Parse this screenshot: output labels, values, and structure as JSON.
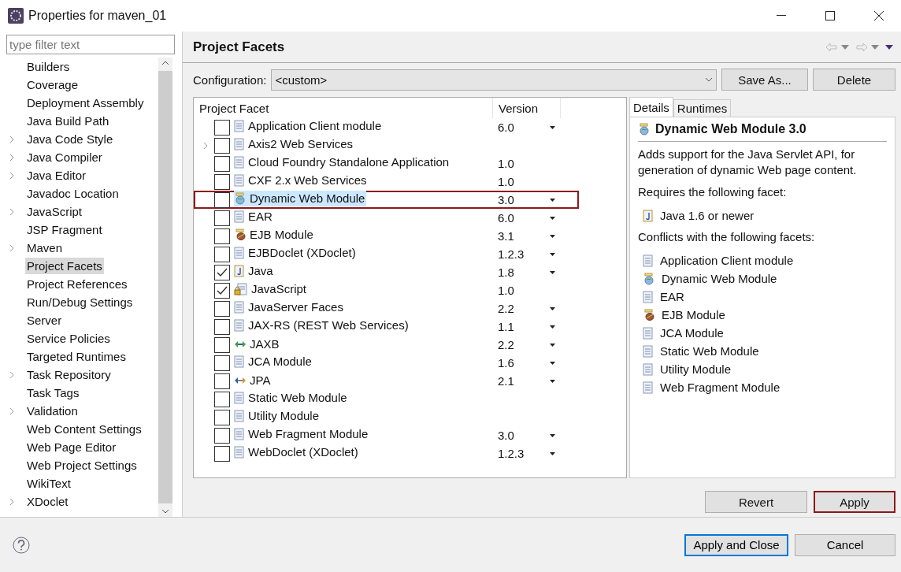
{
  "window": {
    "title": "Properties for maven_01"
  },
  "sidebar": {
    "filter": {
      "placeholder": "type filter text"
    },
    "items": [
      {
        "label": "Builders",
        "expandable": false,
        "selected": false
      },
      {
        "label": "Coverage",
        "expandable": false,
        "selected": false
      },
      {
        "label": "Deployment Assembly",
        "expandable": false,
        "selected": false
      },
      {
        "label": "Java Build Path",
        "expandable": false,
        "selected": false
      },
      {
        "label": "Java Code Style",
        "expandable": true,
        "selected": false
      },
      {
        "label": "Java Compiler",
        "expandable": true,
        "selected": false
      },
      {
        "label": "Java Editor",
        "expandable": true,
        "selected": false
      },
      {
        "label": "Javadoc Location",
        "expandable": false,
        "selected": false
      },
      {
        "label": "JavaScript",
        "expandable": true,
        "selected": false
      },
      {
        "label": "JSP Fragment",
        "expandable": false,
        "selected": false
      },
      {
        "label": "Maven",
        "expandable": true,
        "selected": false
      },
      {
        "label": "Project Facets",
        "expandable": false,
        "selected": true
      },
      {
        "label": "Project References",
        "expandable": false,
        "selected": false
      },
      {
        "label": "Run/Debug Settings",
        "expandable": false,
        "selected": false
      },
      {
        "label": "Server",
        "expandable": false,
        "selected": false
      },
      {
        "label": "Service Policies",
        "expandable": false,
        "selected": false
      },
      {
        "label": "Targeted Runtimes",
        "expandable": false,
        "selected": false
      },
      {
        "label": "Task Repository",
        "expandable": true,
        "selected": false
      },
      {
        "label": "Task Tags",
        "expandable": false,
        "selected": false
      },
      {
        "label": "Validation",
        "expandable": true,
        "selected": false
      },
      {
        "label": "Web Content Settings",
        "expandable": false,
        "selected": false
      },
      {
        "label": "Web Page Editor",
        "expandable": false,
        "selected": false
      },
      {
        "label": "Web Project Settings",
        "expandable": false,
        "selected": false
      },
      {
        "label": "WikiText",
        "expandable": false,
        "selected": false
      },
      {
        "label": "XDoclet",
        "expandable": true,
        "selected": false
      }
    ]
  },
  "page": {
    "title": "Project Facets",
    "configuration": {
      "label": "Configuration:",
      "value": "<custom>",
      "buttons": [
        "Save As...",
        "Delete"
      ]
    },
    "table": {
      "columns": [
        "Project Facet",
        "Version"
      ],
      "rows": [
        {
          "name": "Application Client module",
          "kind": "doc",
          "version": "6.0",
          "dropdown": true,
          "checked": false,
          "expandable": false,
          "selected": false
        },
        {
          "name": "Axis2 Web Services",
          "kind": "doc",
          "version": "",
          "dropdown": false,
          "checked": false,
          "expandable": true,
          "selected": false
        },
        {
          "name": "Cloud Foundry Standalone Application",
          "kind": "doc",
          "version": "1.0",
          "dropdown": false,
          "checked": false,
          "expandable": false,
          "selected": false
        },
        {
          "name": "CXF 2.x Web Services",
          "kind": "doc",
          "version": "1.0",
          "dropdown": false,
          "checked": false,
          "expandable": false,
          "selected": false
        },
        {
          "name": "Dynamic Web Module",
          "kind": "web",
          "version": "3.0",
          "dropdown": true,
          "checked": false,
          "expandable": false,
          "selected": true
        },
        {
          "name": "EAR",
          "kind": "doc",
          "version": "6.0",
          "dropdown": true,
          "checked": false,
          "expandable": false,
          "selected": false
        },
        {
          "name": "EJB Module",
          "kind": "bean",
          "version": "3.1",
          "dropdown": true,
          "checked": false,
          "expandable": false,
          "selected": false
        },
        {
          "name": "EJBDoclet (XDoclet)",
          "kind": "doc",
          "version": "1.2.3",
          "dropdown": true,
          "checked": false,
          "expandable": false,
          "selected": false
        },
        {
          "name": "Java",
          "kind": "java",
          "version": "1.8",
          "dropdown": true,
          "checked": true,
          "expandable": false,
          "selected": false
        },
        {
          "name": "JavaScript",
          "kind": "locked",
          "version": "1.0",
          "dropdown": false,
          "checked": true,
          "expandable": false,
          "selected": false
        },
        {
          "name": "JavaServer Faces",
          "kind": "doc",
          "version": "2.2",
          "dropdown": true,
          "checked": false,
          "expandable": false,
          "selected": false
        },
        {
          "name": "JAX-RS (REST Web Services)",
          "kind": "doc",
          "version": "1.1",
          "dropdown": true,
          "checked": false,
          "expandable": false,
          "selected": false
        },
        {
          "name": "JAXB",
          "kind": "green-arrows",
          "version": "2.2",
          "dropdown": true,
          "checked": false,
          "expandable": false,
          "selected": false
        },
        {
          "name": "JCA Module",
          "kind": "doc",
          "version": "1.6",
          "dropdown": true,
          "checked": false,
          "expandable": false,
          "selected": false
        },
        {
          "name": "JPA",
          "kind": "orange-arrows",
          "version": "2.1",
          "dropdown": true,
          "checked": false,
          "expandable": false,
          "selected": false
        },
        {
          "name": "Static Web Module",
          "kind": "doc",
          "version": "",
          "dropdown": false,
          "checked": false,
          "expandable": false,
          "selected": false
        },
        {
          "name": "Utility Module",
          "kind": "doc",
          "version": "",
          "dropdown": false,
          "checked": false,
          "expandable": false,
          "selected": false
        },
        {
          "name": "Web Fragment Module",
          "kind": "doc",
          "version": "3.0",
          "dropdown": true,
          "checked": false,
          "expandable": false,
          "selected": false
        },
        {
          "name": "WebDoclet (XDoclet)",
          "kind": "doc",
          "version": "1.2.3",
          "dropdown": true,
          "checked": false,
          "expandable": false,
          "selected": false
        }
      ]
    },
    "details": {
      "tabs": [
        {
          "label": "Details",
          "selected": true
        },
        {
          "label": "Runtimes",
          "selected": false
        }
      ],
      "heading": {
        "label": "Dynamic Web Module 3.0",
        "kind": "web"
      },
      "description": "Adds support for the Java Servlet API, for generation of dynamic Web page content.",
      "requires_label": "Requires the following facet:",
      "requires": [
        {
          "label": "Java 1.6 or newer",
          "kind": "java"
        }
      ],
      "conflicts_label": "Conflicts with the following facets:",
      "conflicts": [
        {
          "label": "Application Client module",
          "kind": "doc"
        },
        {
          "label": "Dynamic Web Module",
          "kind": "web"
        },
        {
          "label": "EAR",
          "kind": "doc"
        },
        {
          "label": "EJB Module",
          "kind": "bean"
        },
        {
          "label": "JCA Module",
          "kind": "doc"
        },
        {
          "label": "Static Web Module",
          "kind": "doc"
        },
        {
          "label": "Utility Module",
          "kind": "doc"
        },
        {
          "label": "Web Fragment Module",
          "kind": "doc"
        }
      ]
    },
    "actions": [
      {
        "label": "Revert",
        "selected": false
      },
      {
        "label": "Apply",
        "selected": true
      }
    ]
  },
  "footer": {
    "buttons": [
      {
        "label": "Apply and Close",
        "selected": true
      },
      {
        "label": "Cancel",
        "selected": false
      }
    ]
  }
}
